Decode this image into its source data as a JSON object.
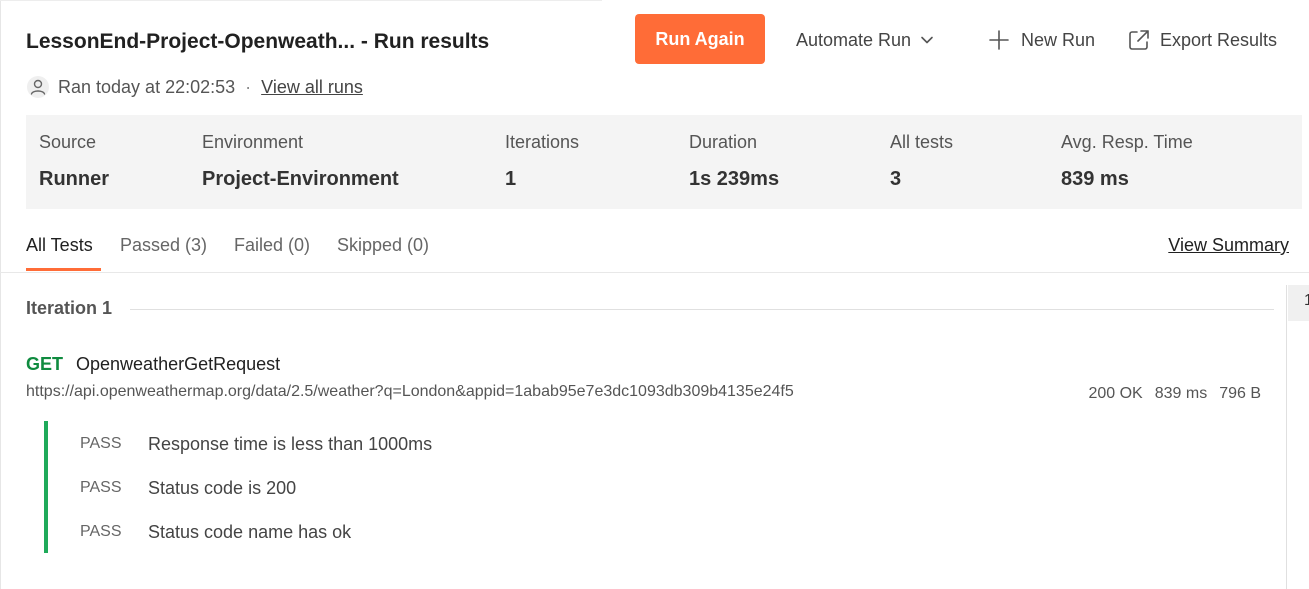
{
  "header": {
    "title": "LessonEnd-Project-Openweath... - Run results",
    "run_again_label": "Run Again",
    "automate_run_label": "Automate Run",
    "new_run_label": "New Run",
    "export_results_label": "Export Results",
    "accent_color": "#ff6c37"
  },
  "meta": {
    "ran_text": "Ran today at 22:02:53",
    "separator": "·",
    "view_all_runs_label": "View all runs"
  },
  "stats": [
    {
      "label": "Source",
      "value": "Runner"
    },
    {
      "label": "Environment",
      "value": "Project-Environment"
    },
    {
      "label": "Iterations",
      "value": "1"
    },
    {
      "label": "Duration",
      "value": "1s 239ms"
    },
    {
      "label": "All tests",
      "value": "3"
    },
    {
      "label": "Avg. Resp. Time",
      "value": "839 ms"
    }
  ],
  "tabs": [
    {
      "label": "All Tests",
      "active": true
    },
    {
      "label": "Passed (3)",
      "active": false
    },
    {
      "label": "Failed (0)",
      "active": false
    },
    {
      "label": "Skipped (0)",
      "active": false
    }
  ],
  "view_summary_label": "View Summary",
  "iteration": {
    "label": "Iteration 1",
    "marker": "1"
  },
  "request": {
    "method": "GET",
    "name": "OpenweatherGetRequest",
    "url": "https://api.openweathermap.org/data/2.5/weather?q=London&appid=1abab95e7e3dc1093db309b4135e24f5",
    "status": "200 OK",
    "time": "839 ms",
    "size": "796 B",
    "method_color": "#0f8b3f"
  },
  "tests": [
    {
      "status": "PASS",
      "name": "Response time is less than 1000ms"
    },
    {
      "status": "PASS",
      "name": "Status code is 200"
    },
    {
      "status": "PASS",
      "name": "Status code name has ok"
    }
  ],
  "pass_color": "#1faa5a"
}
